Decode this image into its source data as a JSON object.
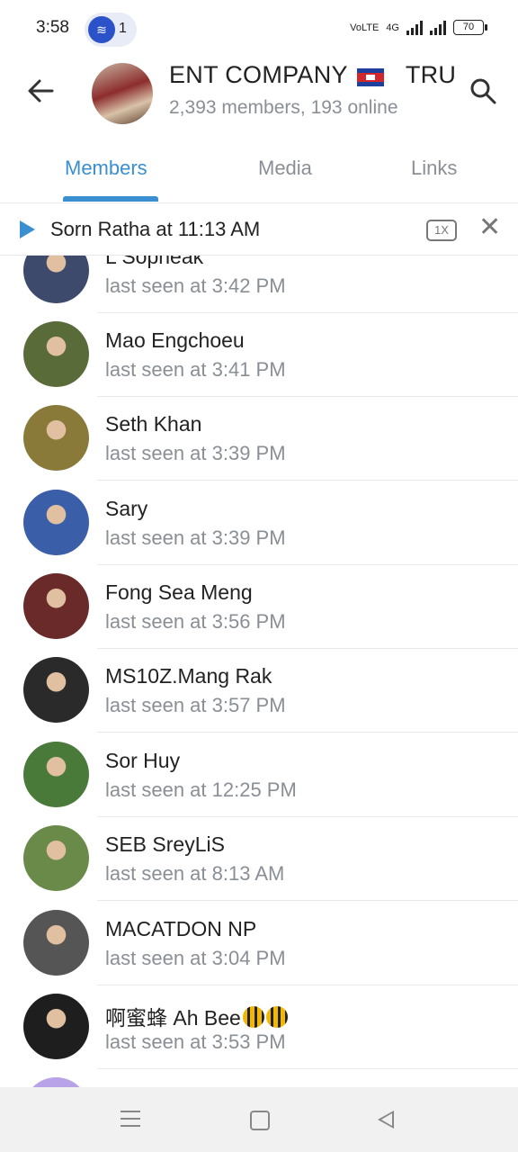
{
  "status_bar": {
    "time": "3:58",
    "notification_count": "1",
    "network": "VoLTE",
    "network_type": "4G",
    "battery": "70"
  },
  "header": {
    "title_left": "ENT COMPANY",
    "title_right": "TRU",
    "subtitle": "2,393 members, 193 online",
    "back_icon": "arrow-left-icon",
    "search_icon": "search-icon"
  },
  "tabs": [
    {
      "label": "Members",
      "active": true
    },
    {
      "label": "Media",
      "active": false
    },
    {
      "label": "Links",
      "active": false
    }
  ],
  "player": {
    "name": "Sorn Ratha",
    "time_text": "at 11:13 AM",
    "speed": "1X"
  },
  "members": [
    {
      "name": "L Sopneak",
      "last_seen": "last seen at 3:42 PM",
      "avatar_color": "#3d4a6b"
    },
    {
      "name": "Mao Engchoeu",
      "last_seen": "last seen at 3:41 PM",
      "avatar_color": "#5a6b3a"
    },
    {
      "name": "Seth Khan",
      "last_seen": "last seen at 3:39 PM",
      "avatar_color": "#8a7a3a"
    },
    {
      "name": "Sary",
      "last_seen": "last seen at 3:39 PM",
      "avatar_color": "#3b5ea8"
    },
    {
      "name": "Fong Sea Meng",
      "last_seen": "last seen at 3:56 PM",
      "avatar_color": "#6a2a2a"
    },
    {
      "name": "MS10Z.Mang Rak",
      "last_seen": "last seen at 3:57 PM",
      "avatar_color": "#2a2a2a"
    },
    {
      "name": "Sor Huy",
      "last_seen": "last seen at 12:25 PM",
      "avatar_color": "#4a7a3a"
    },
    {
      "name": "SEB SreyLiS",
      "last_seen": "last seen at 8:13 AM",
      "avatar_color": "#6a8a4a"
    },
    {
      "name": "MACATDON NP",
      "last_seen": "last seen at 3:04 PM",
      "avatar_color": "#555555"
    },
    {
      "name": "啊蜜蜂 Ah Bee",
      "last_seen": "last seen at 3:53 PM",
      "avatar_color": "#1e1e1e"
    }
  ],
  "nav": {
    "menu_icon": "menu-icon",
    "home_icon": "home-icon",
    "back_icon": "back-triangle-icon"
  }
}
